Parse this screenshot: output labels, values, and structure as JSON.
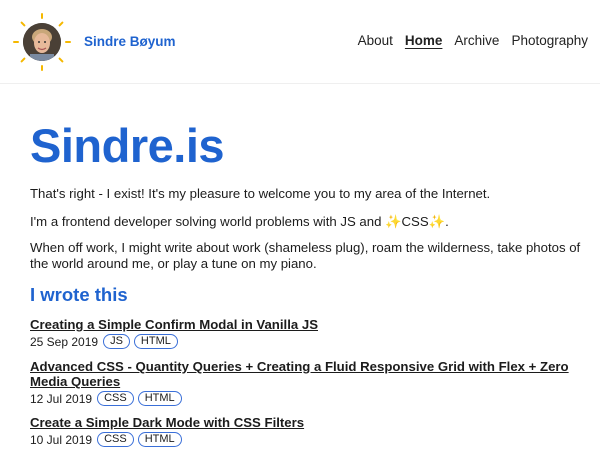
{
  "header": {
    "site_name": "Sindre Bøyum",
    "nav": [
      {
        "label": "About"
      },
      {
        "label": "Home"
      },
      {
        "label": "Archive"
      },
      {
        "label": "Photography"
      }
    ]
  },
  "hero": {
    "title": "Sindre.is",
    "intro": "That's right - I exist! It's my pleasure to welcome you to my area of the Internet.",
    "dev_prefix": "I'm a frontend developer solving world problems with JS and ",
    "dev_sparkle_left": "✨",
    "dev_css": "CSS",
    "dev_sparkle_right": "✨",
    "dev_suffix": ".",
    "off_work": "When off work, I might write about work (shameless plug), roam the wilderness, take photos of the world around me, or play a tune on my piano."
  },
  "posts_section": {
    "title": "I wrote this",
    "posts": [
      {
        "title": "Creating a Simple Confirm Modal in Vanilla JS",
        "date": "25 Sep 2019",
        "tags": [
          "JS",
          "HTML"
        ]
      },
      {
        "title": "Advanced CSS - Quantity Queries + Creating a Fluid Responsive Grid with Flex + Zero Media Queries",
        "date": "12 Jul 2019",
        "tags": [
          "CSS",
          "HTML"
        ]
      },
      {
        "title": "Create a Simple Dark Mode with CSS Filters",
        "date": "10 Jul 2019",
        "tags": [
          "CSS",
          "HTML"
        ]
      }
    ]
  },
  "colors": {
    "accent": "#1f63cf",
    "sun": "#f5b800",
    "tag_border": "#3a6fd8"
  },
  "icons": {
    "logo": "sun-avatar-icon"
  }
}
